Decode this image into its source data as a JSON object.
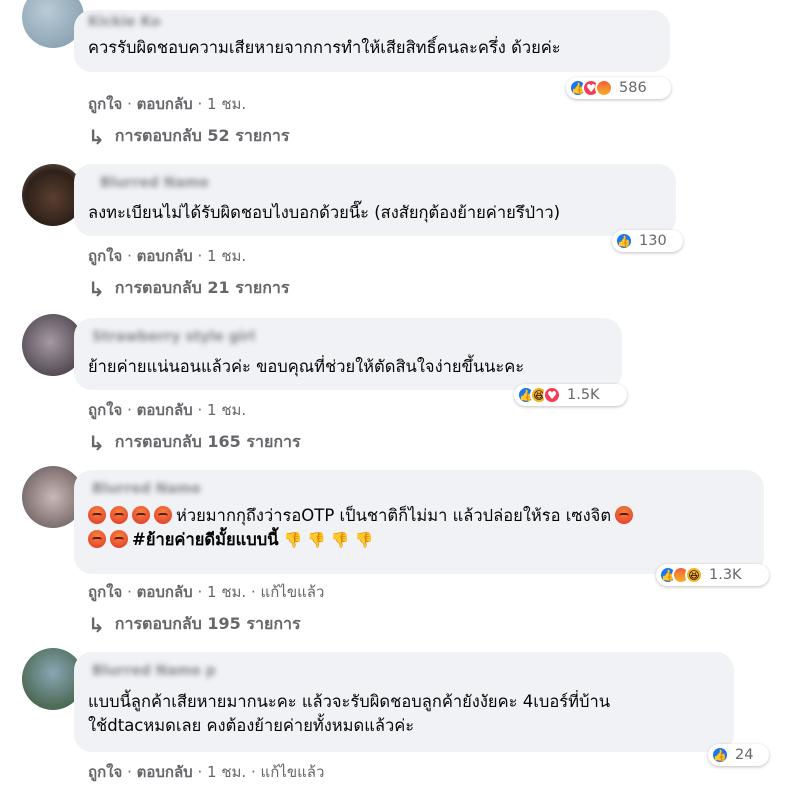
{
  "comments": [
    {
      "author": "Kickie Ko",
      "text": "ควรรับผิดชอบความเสียหายจากการทำให้เสียสิทธิ์คนละครึ่ง ด้วยค่ะ",
      "reaction_icons": [
        "like-icon",
        "love-icon",
        "angry-icon"
      ],
      "reaction_count": "586",
      "like": "ถูกใจ",
      "reply": "ตอบกลับ",
      "time": "1 ชม.",
      "edited": "",
      "replies_text": "การตอบกลับ 52 รายการ"
    },
    {
      "author": "Blurred Name",
      "text": "ลงทะเบียนไม่ได้รับผิดชอบไงบอกด้วยนี๊ะ (สงสัยกุต้องย้ายค่ายรึป่าว)",
      "reaction_icons": [
        "like-icon"
      ],
      "reaction_count": "130",
      "like": "ถูกใจ",
      "reply": "ตอบกลับ",
      "time": "1 ชม.",
      "edited": "",
      "replies_text": "การตอบกลับ 21 รายการ"
    },
    {
      "author": "Strawberry style girl",
      "text": "ย้ายค่ายแน่นอนแล้วค่ะ ขอบคุณที่ช่วยให้ตัดสินใจง่ายขึ้นนะคะ",
      "reaction_icons": [
        "like-icon",
        "haha-icon",
        "love-icon"
      ],
      "reaction_count": "1.5K",
      "like": "ถูกใจ",
      "reply": "ตอบกลับ",
      "time": "1 ชม.",
      "edited": "",
      "replies_text": "การตอบกลับ 165 รายการ"
    },
    {
      "author": "Blurred Name",
      "text_line1": "ห่วยมากกุถึงว่ารอOTP เป็นชาติก็ไม่มา แล้วปล่อยให้รอ เซงจิต",
      "hashtag": "#ย้ายค่ายดีมั้ยแบบนี้",
      "reaction_icons": [
        "like-icon",
        "angry-icon",
        "haha-icon"
      ],
      "reaction_count": "1.3K",
      "like": "ถูกใจ",
      "reply": "ตอบกลับ",
      "time": "1 ชม.",
      "edited": "แก้ไขแล้ว",
      "replies_text": "การตอบกลับ 195 รายการ"
    },
    {
      "author": "Blurred Name p",
      "text_line1": "แบบนี้ลูกค้าเสียหายมากนะคะ แล้วจะรับผิดชอบลูกค้ายังงัยคะ 4เบอร์ที่บ้าน",
      "text_line2": "ใช้dtacหมดเลย คงต้องย้ายค่ายทั้งหมดแล้วค่ะ",
      "reaction_icons": [
        "like-icon"
      ],
      "reaction_count": "24",
      "like": "ถูกใจ",
      "reply": "ตอบกลับ",
      "time": "1 ชม.",
      "edited": "แก้ไขแล้ว"
    }
  ],
  "separator": "·",
  "reply_arrow": "↳",
  "colors": {
    "bubble": "#f0f2f5",
    "meta": "#65676b",
    "like": "#1877f2",
    "love": "#f33e58",
    "angry": "#f2603e",
    "haha": "#f7b125"
  }
}
